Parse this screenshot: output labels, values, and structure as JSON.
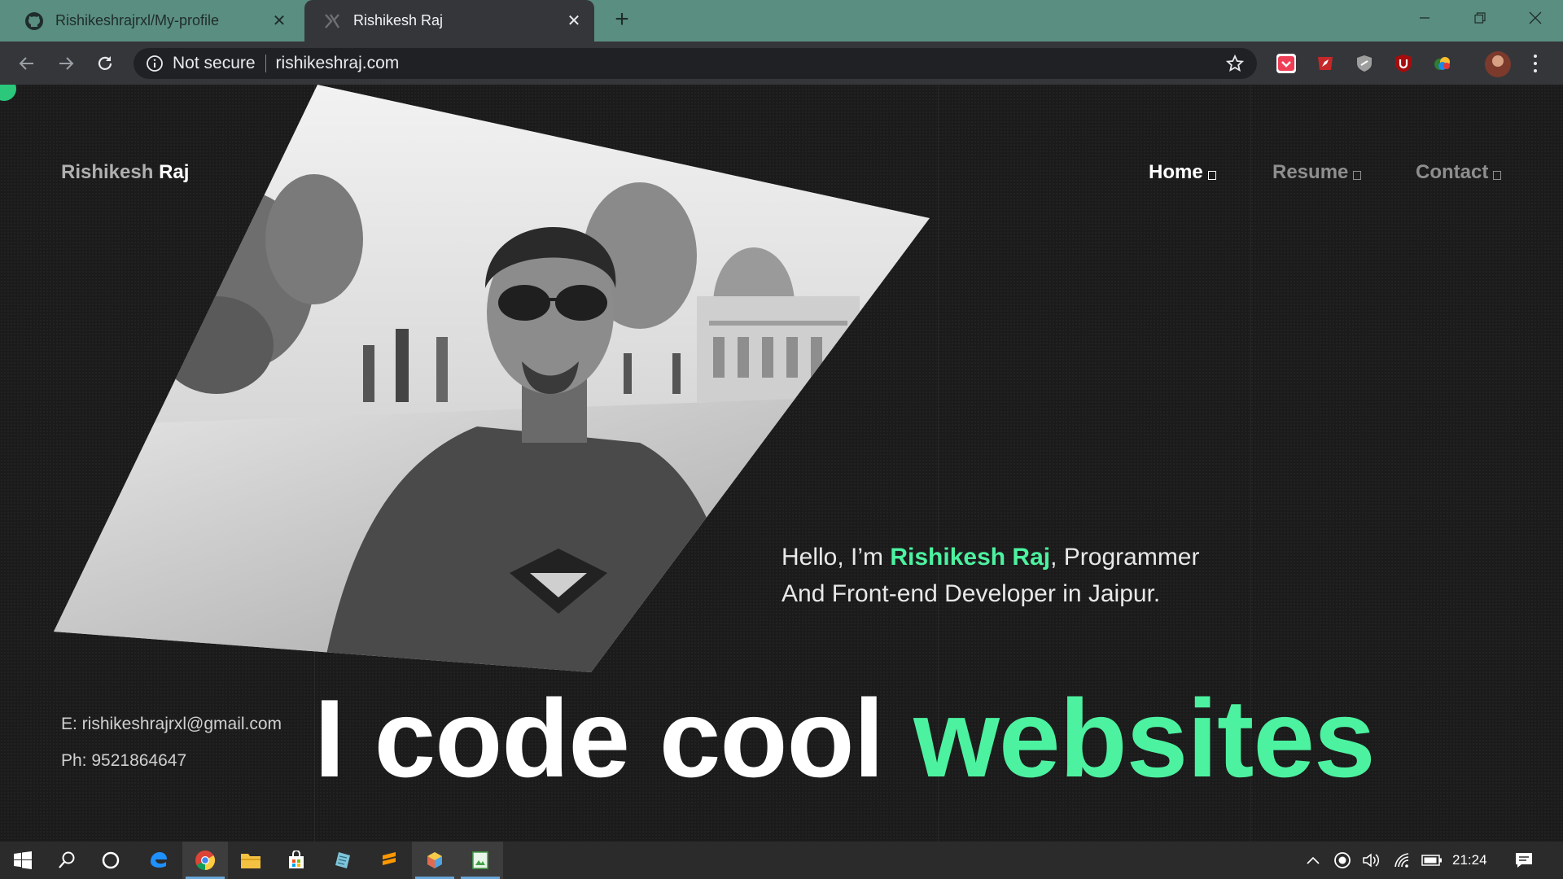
{
  "browser": {
    "tabs": [
      {
        "title": "Rishikeshrajrxl/My-profile",
        "favicon": "github-icon",
        "active": false
      },
      {
        "title": "Rishikesh Raj",
        "favicon": "site-icon",
        "active": true
      }
    ],
    "new_tab": "+",
    "security_label": "Not secure",
    "url": "rishikeshraj.com",
    "extensions": [
      "pocket-icon",
      "rocket-extension-icon",
      "shield-extension-icon",
      "ublock-icon",
      "color-picker-icon"
    ]
  },
  "site": {
    "logo_first": "Rishikesh",
    "logo_second": "Raj",
    "nav": [
      {
        "label": "Home",
        "active": true
      },
      {
        "label": "Resume",
        "active": false
      },
      {
        "label": "Contact",
        "active": false
      }
    ],
    "intro": {
      "prefix": "Hello, I’m ",
      "name": "Rishikesh Raj",
      "suffix": ", Programmer And Front-end Developer in Jaipur."
    },
    "email": "E: rishikeshrajrxl@gmail.com",
    "phone": "Ph: 9521864647",
    "headline_start": "I code cool ",
    "headline_accent": "websites",
    "accent_color": "#4cf2a0"
  },
  "taskbar": {
    "apps": [
      "start-icon",
      "search-icon",
      "cortana-icon",
      "edge-icon",
      "chrome-icon",
      "file-explorer-icon",
      "store-icon",
      "notepad-icon",
      "sublime-icon",
      "box-app-icon",
      "image-editor-icon"
    ],
    "time": "21:24"
  }
}
